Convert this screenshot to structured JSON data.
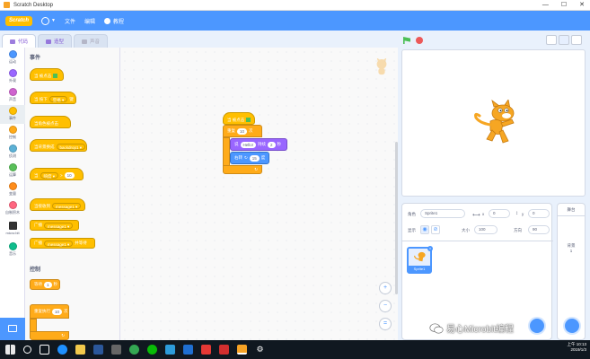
{
  "window": {
    "title": "Scratch Desktop",
    "controls": [
      "—",
      "☐",
      "✕"
    ]
  },
  "menubar": {
    "logo": "Scratch",
    "items": [
      {
        "label": "文件"
      },
      {
        "label": "编辑"
      },
      {
        "label": "教程"
      }
    ]
  },
  "tabs": [
    {
      "label": "代码",
      "active": true
    },
    {
      "label": "造型",
      "active": false
    },
    {
      "label": "声音",
      "active": false
    }
  ],
  "categories": [
    {
      "label": "运动",
      "color": "#4c97ff"
    },
    {
      "label": "外观",
      "color": "#9966ff"
    },
    {
      "label": "声音",
      "color": "#cf63cf"
    },
    {
      "label": "事件",
      "color": "#ffbf00"
    },
    {
      "label": "控制",
      "color": "#ffab19"
    },
    {
      "label": "侦测",
      "color": "#5cb1d6"
    },
    {
      "label": "运算",
      "color": "#59c059"
    },
    {
      "label": "变量",
      "color": "#ff8c1a"
    },
    {
      "label": "自制积木",
      "color": "#ff6680"
    },
    {
      "label": "micro:bit",
      "color": "#333333"
    },
    {
      "label": "音乐",
      "color": "#0fbd8c"
    }
  ],
  "palette": {
    "events_title": "事件",
    "control_title": "控制",
    "blocks": [
      {
        "text": "当 被点击"
      },
      {
        "text": "当 按下",
        "dd": "空格 ▾",
        "tail": "键"
      },
      {
        "text": "当角色被点击"
      },
      {
        "text": "当背景换成",
        "dd": "backdrop1 ▾"
      },
      {
        "text": "当",
        "dd": "响度 ▾",
        "tail": ">",
        "num": "10"
      },
      {
        "text": "当接收到",
        "dd": "message1 ▾"
      },
      {
        "text": "广播",
        "dd": "message1 ▾"
      },
      {
        "text": "广播",
        "dd": "message1 ▾",
        "tail": "并等待"
      },
      {
        "text": "等待",
        "num": "1",
        "tail": "秒"
      },
      {
        "text": "重复执行",
        "num": "10",
        "tail": "次"
      }
    ]
  },
  "script": {
    "hat": "当 被点击",
    "repeat_label": "重复",
    "repeat_num": "10",
    "repeat_tail": "次",
    "say_label": "说",
    "say_text": "Hello!",
    "say_mid": "持续",
    "say_num": "2",
    "say_tail": "秒",
    "turn_label": "右转",
    "turn_num": "15",
    "turn_tail": "度"
  },
  "sprite_info": {
    "sprite_label": "角色",
    "sprite_name": "Sprite1",
    "x_label": "x",
    "x_value": "0",
    "y_label": "y",
    "y_value": "0",
    "show_label": "显示",
    "size_label": "大小",
    "size_value": "100",
    "direction_label": "方向",
    "direction_value": "90"
  },
  "sprites": [
    {
      "name": "Sprite1"
    }
  ],
  "stage_pane": {
    "title": "舞台",
    "backdrops_label": "背景",
    "backdrops_count": "1"
  },
  "watermark": "易心Microbit编程",
  "taskbar": {
    "time": "10:13",
    "date": "2019/1/3",
    "ime": "上午"
  }
}
